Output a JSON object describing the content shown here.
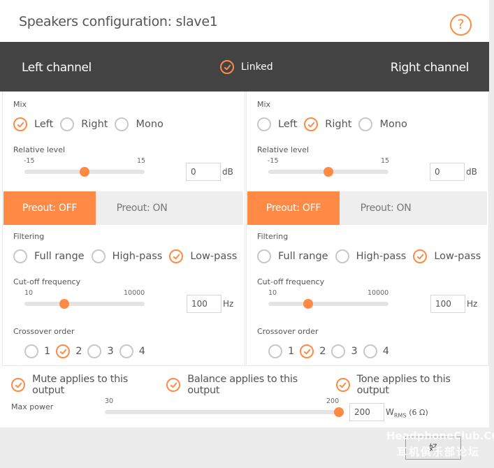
{
  "title": "Speakers configuration: slave1",
  "help_glyph": "?",
  "channels": {
    "left_label": "Left channel",
    "right_label": "Right channel",
    "linked_label": "Linked",
    "linked": true
  },
  "accent_color": "#ff8a45",
  "panels": [
    {
      "id": "left",
      "mix": {
        "label": "Mix",
        "options": [
          "Left",
          "Right",
          "Mono"
        ],
        "selected": "Left"
      },
      "relative_level": {
        "label": "Relative level",
        "min": "-15",
        "max": "15",
        "value": "0",
        "fraction": 0.5,
        "unit": "dB"
      },
      "preout": {
        "off_label": "Preout: OFF",
        "on_label": "Preout: ON",
        "selected": "off"
      },
      "filtering": {
        "label": "Filtering",
        "options": [
          "Full range",
          "High-pass",
          "Low-pass"
        ],
        "selected": "Low-pass"
      },
      "cutoff": {
        "label": "Cut-off frequency",
        "min": "10",
        "max": "10000",
        "value": "100",
        "fraction": 0.333,
        "unit": "Hz"
      },
      "crossover": {
        "label": "Crossover order",
        "options": [
          "1",
          "2",
          "3",
          "4"
        ],
        "selected": "2"
      }
    },
    {
      "id": "right",
      "mix": {
        "label": "Mix",
        "options": [
          "Left",
          "Right",
          "Mono"
        ],
        "selected": "Right"
      },
      "relative_level": {
        "label": "Relative level",
        "min": "-15",
        "max": "15",
        "value": "0",
        "fraction": 0.5,
        "unit": "dB"
      },
      "preout": {
        "off_label": "Preout: OFF",
        "on_label": "Preout: ON",
        "selected": "off"
      },
      "filtering": {
        "label": "Filtering",
        "options": [
          "Full range",
          "High-pass",
          "Low-pass"
        ],
        "selected": "Low-pass"
      },
      "cutoff": {
        "label": "Cut-off frequency",
        "min": "10",
        "max": "10000",
        "value": "100",
        "fraction": 0.333,
        "unit": "Hz"
      },
      "crossover": {
        "label": "Crossover order",
        "options": [
          "1",
          "2",
          "3",
          "4"
        ],
        "selected": "2"
      }
    }
  ],
  "output_options": [
    {
      "label": "Mute applies to this output",
      "checked": true
    },
    {
      "label": "Balance applies to this output",
      "checked": true
    },
    {
      "label": "Tone applies to this output",
      "checked": true
    }
  ],
  "max_power": {
    "label": "Max power",
    "min": "30",
    "max": "200",
    "value": "200",
    "fraction": 1.0,
    "unit_main": "W",
    "unit_sub": "RMS",
    "unit_suffix": "(6 Ω)"
  },
  "footer": {
    "ok_label": "好"
  },
  "watermark": {
    "line1": "HeadphoneClub.COM",
    "line2": "耳机俱乐部论坛"
  }
}
